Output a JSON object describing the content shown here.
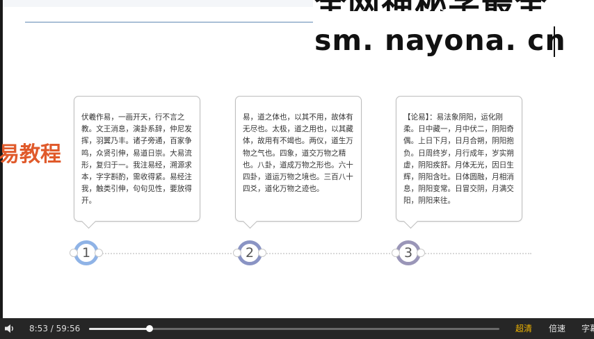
{
  "watermark": {
    "line1": "全网神秘学最全",
    "line2": "sm. nayona. cn"
  },
  "side_title": "易教程",
  "boxes": [
    {
      "text": "伏羲作易，一画开天，行不言之教。文王消息，演卦系辞，仲尼发挥，羽翼乃丰。诸子旁通，百家争鸣，众贤引伸，易道日崇。大易流形，复归于一。我注易经，溯源求本，字字斟酌，需收得紧。易经注我，触类引伸，句句见性，要放得开。"
    },
    {
      "text": "易，道之体也，以其不用，故体有无尽也。太极，道之用也，以其藏体，故用有不竭也。两仪，道生万物之气也。四象，道交万物之精也。八卦，道成万物之形也。六十四卦，道运万物之境也。三百八十四爻，道化万物之迹也。"
    },
    {
      "text": "【论易】：易法象阴阳，运化刚柔。日中藏一，月中伏二，阴阳奇偶。上日下月，日月合朔，阴阳抱负。日周终岁，月行成年，岁实朔虚，阴阳疾舒。月体无光，因日生辉，阴阳含吐。日体圆融，月相消息，阴阳变常。日冒交阴，月满交阳，阴阳来往。"
    }
  ],
  "markers": [
    "1",
    "2",
    "3"
  ],
  "player": {
    "current_time": "8:53",
    "separator": "/",
    "total_time": "59:56",
    "progress": 0.148,
    "quality_label": "超清",
    "speed_label": "倍速",
    "subtitle_label": "字幕"
  },
  "colors": {
    "side_title": "#e05a2b",
    "quality_active": "#f0b400",
    "marker_1": "#8fb3e6",
    "marker_2": "#8a94c4",
    "marker_3": "#9a96b8"
  }
}
